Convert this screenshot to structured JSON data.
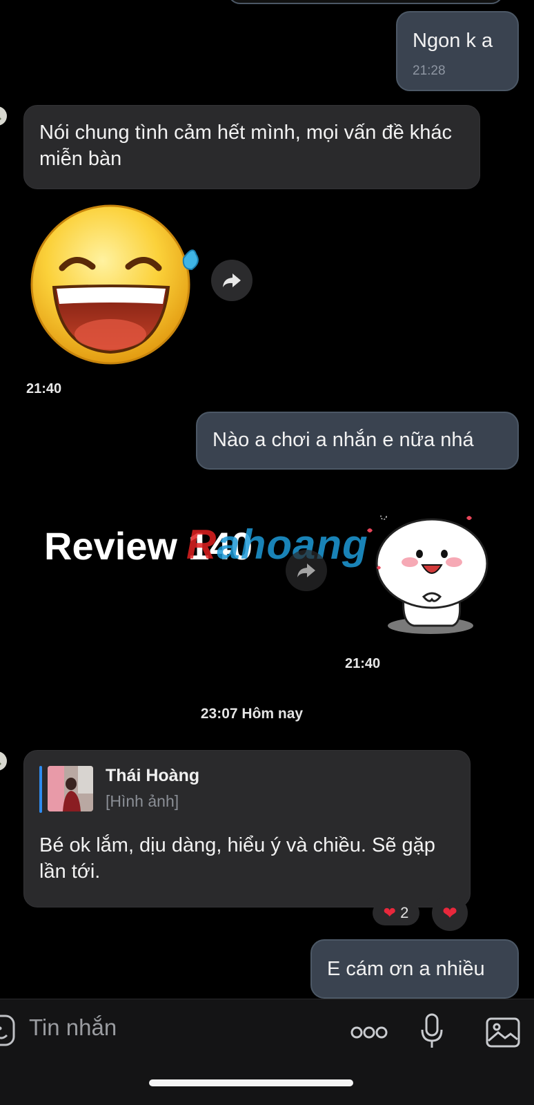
{
  "messages": {
    "m1": {
      "text": "Ngon k a",
      "time": "21:28"
    },
    "m2": {
      "text": "Nói chung tình cảm hết mình, mọi vấn đề khác miễn bàn"
    },
    "m3": {
      "sticker": "laughing-tears-emoji",
      "time": "21:40"
    },
    "m4": {
      "text": "Nào a chơi a nhắn e nữa nhá"
    },
    "m5": {
      "sticker": "cute-white-blob-sticker",
      "time": "21:40"
    },
    "m6": {
      "reply": {
        "name": "Thái Hoàng",
        "attachment": "[Hình ảnh]"
      },
      "text": "Bé ok lắm, dịu dàng, hiểu ý và chiều. Sẽ gặp lần tới.",
      "reaction_count": "2"
    },
    "m7": {
      "text": "E cám ơn a nhiều"
    }
  },
  "date_separator": "23:07 Hôm nay",
  "watermark": {
    "label": "Review 140",
    "logo_r": "R",
    "logo_rest": "ahoang"
  },
  "input": {
    "placeholder": "Tin nhắn"
  },
  "colors": {
    "outgoing_bubble": "#3a4350",
    "incoming_bubble": "#2a2a2c",
    "background": "#000000",
    "reply_accent": "#2e8bf0"
  }
}
